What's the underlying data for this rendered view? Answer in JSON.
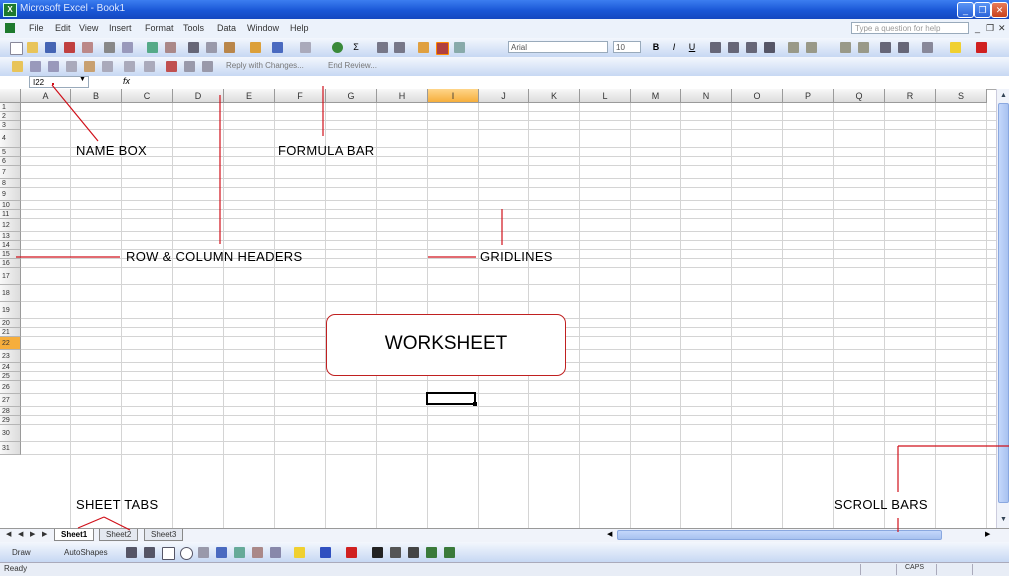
{
  "window": {
    "title": "Microsoft Excel - Book1",
    "app_icon": "excel-logo-icon",
    "controls": [
      "_",
      "❐",
      "✕"
    ]
  },
  "menu": {
    "items": [
      "File",
      "Edit",
      "View",
      "Insert",
      "Format",
      "Tools",
      "Data",
      "Window",
      "Help"
    ],
    "help_placeholder": "Type a question for help",
    "doc_controls": [
      "_",
      "❐",
      "✕"
    ]
  },
  "formatting": {
    "font": "Arial",
    "size": "10",
    "bold": "B",
    "italic": "I",
    "underline": "U",
    "zoom_label": "Σ"
  },
  "reviewing": {
    "reply_text": "Reply with Changes...",
    "end_review": "End Review..."
  },
  "formula_bar": {
    "name_box": "I22",
    "fx": "fx",
    "content": ""
  },
  "columns": [
    "A",
    "B",
    "C",
    "D",
    "E",
    "F",
    "G",
    "H",
    "I",
    "J",
    "K",
    "L",
    "M",
    "N",
    "O",
    "P",
    "Q",
    "R",
    "S"
  ],
  "rows": [
    "1",
    "2",
    "3",
    "4",
    "5",
    "6",
    "7",
    "8",
    "9",
    "10",
    "11",
    "12",
    "13",
    "14",
    "15",
    "16",
    "17",
    "18",
    "19",
    "20",
    "21",
    "22",
    "23",
    "24",
    "25",
    "26",
    "27",
    "28",
    "29",
    "30",
    "31"
  ],
  "selection": {
    "cell": "I22",
    "column": "I",
    "row": "22"
  },
  "sheets": [
    "Sheet1",
    "Sheet2",
    "Sheet3"
  ],
  "active_sheet": "Sheet1",
  "drawing": {
    "draw_label": "Draw",
    "autoshapes_label": "AutoShapes"
  },
  "status": {
    "left": "Ready",
    "caps": "CAPS"
  },
  "annotations": {
    "name_box": "NAME BOX",
    "formula_bar": "FORMULA BAR",
    "headers": "ROW & COLUMN HEADERS",
    "gridlines": "GRIDLINES",
    "worksheet": "WORKSHEET",
    "sheet_tabs": "SHEET TABS",
    "scroll_bars": "SCROLL BARS"
  },
  "colors": {
    "title_bar": "#1a57d6",
    "annotation_line": "#d0101a",
    "selected_header": "#f6ae3c"
  }
}
